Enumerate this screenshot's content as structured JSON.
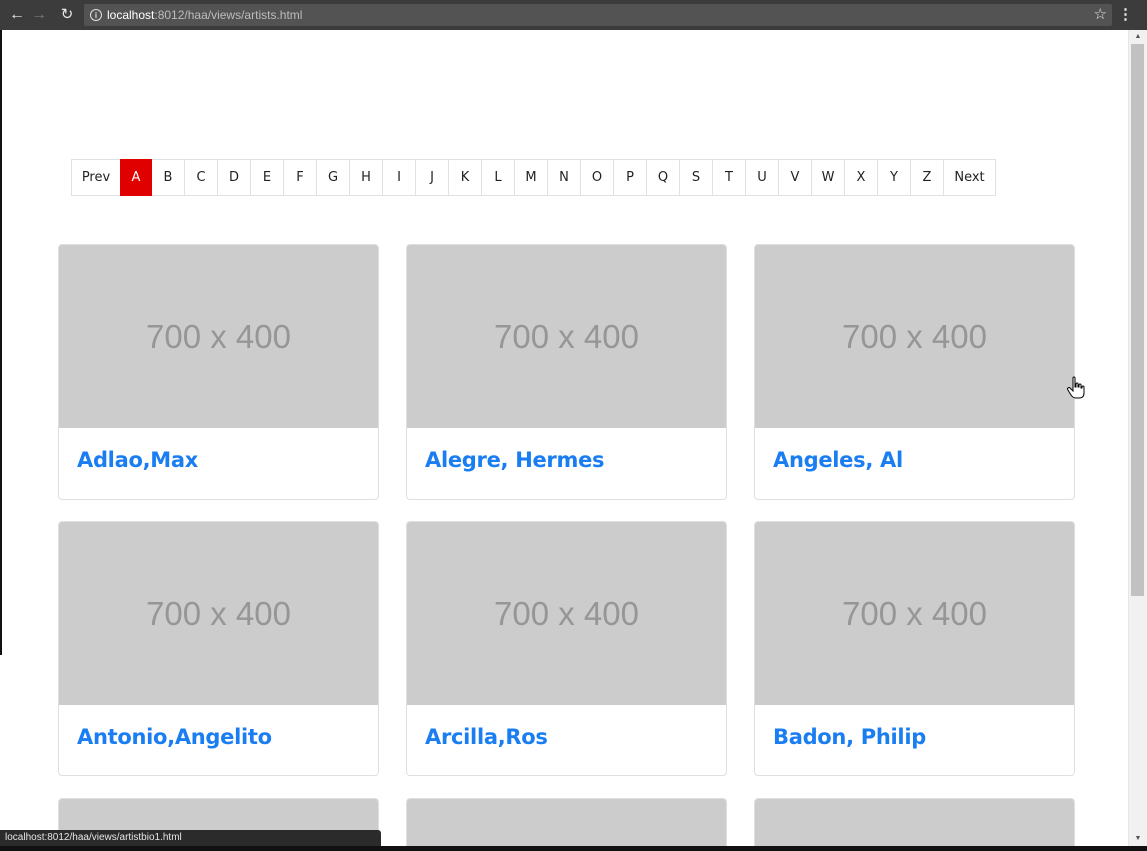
{
  "browser": {
    "back_icon": "arrow-left-icon",
    "forward_icon": "arrow-right-icon",
    "reload_icon": "reload-icon",
    "info_icon": "info-icon",
    "url_host": "localhost",
    "url_path": ":8012/haa/views/artists.html",
    "star_icon": "star-icon",
    "menu_icon": "kebab-menu-icon",
    "status_url": "localhost:8012/haa/views/artistbio1.html"
  },
  "pagination": {
    "prev_label": "Prev",
    "next_label": "Next",
    "active": "A",
    "active_color": "#e00000",
    "letters": [
      "A",
      "B",
      "C",
      "D",
      "E",
      "F",
      "G",
      "H",
      "I",
      "J",
      "K",
      "L",
      "M",
      "N",
      "O",
      "P",
      "Q",
      "S",
      "T",
      "U",
      "V",
      "W",
      "X",
      "Y",
      "Z"
    ]
  },
  "cards": [
    {
      "placeholder": "700 x 400",
      "name": "Adlao,Max"
    },
    {
      "placeholder": "700 x 400",
      "name": "Alegre, Hermes"
    },
    {
      "placeholder": "700 x 400",
      "name": "Angeles, Al"
    },
    {
      "placeholder": "700 x 400",
      "name": "Antonio,Angelito"
    },
    {
      "placeholder": "700 x 400",
      "name": "Arcilla,Ros"
    },
    {
      "placeholder": "700 x 400",
      "name": "Badon, Philip"
    }
  ],
  "colors": {
    "link": "#1a7ef2",
    "placeholder_bg": "#cccccc",
    "chrome_bg": "#3c3c3c"
  }
}
